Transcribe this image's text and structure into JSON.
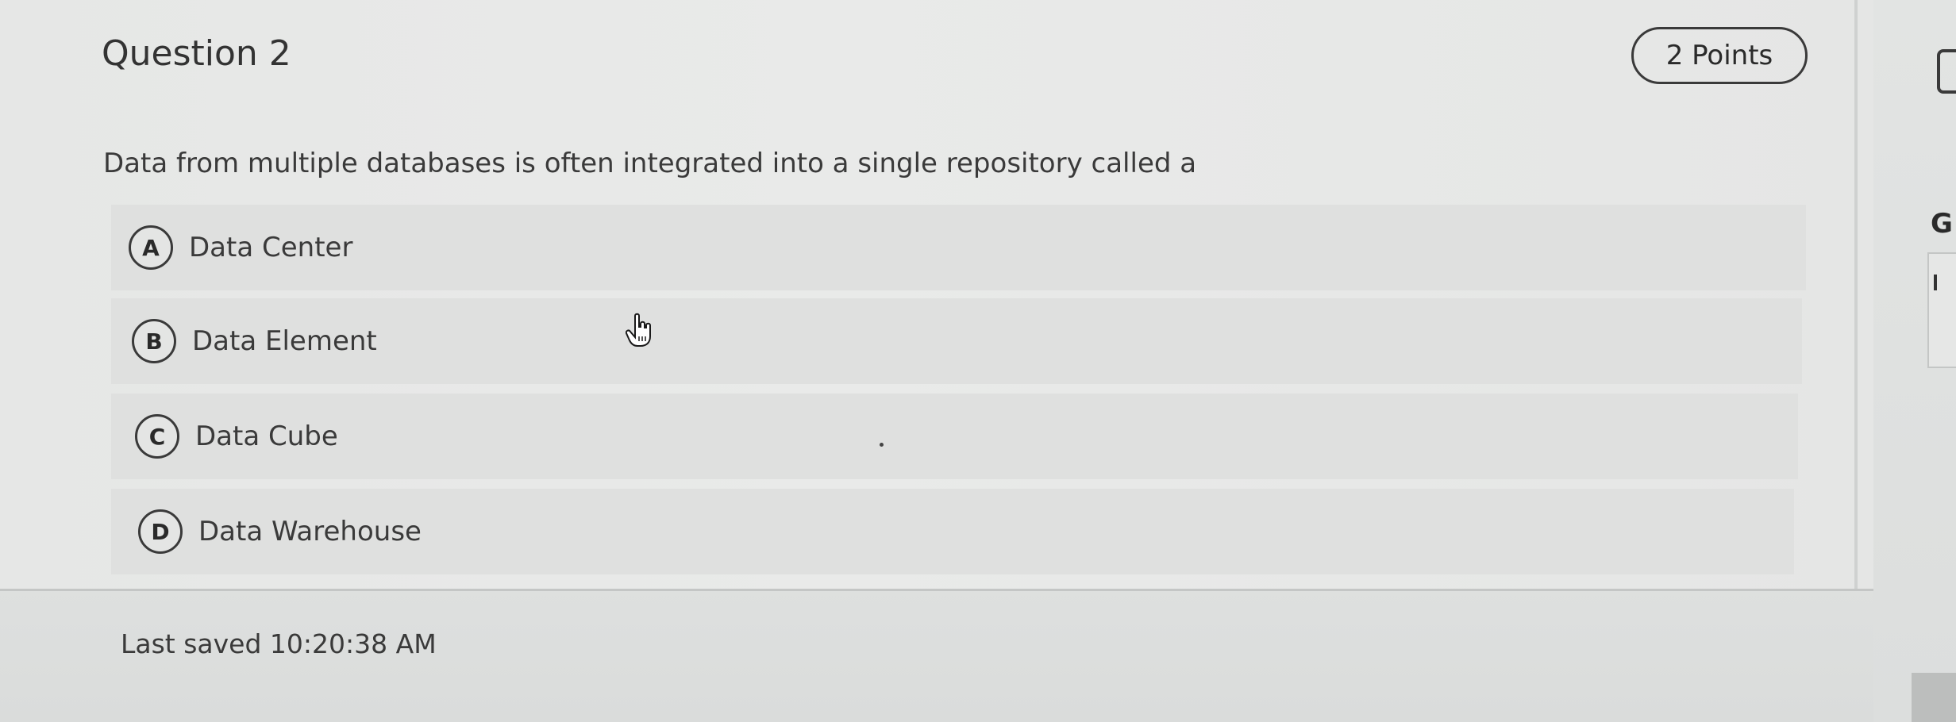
{
  "question": {
    "title": "Question 2",
    "points_label": "2 Points",
    "text": "Data from multiple databases is often integrated into a single repository called a"
  },
  "options": [
    {
      "letter": "A",
      "label": "Data Center"
    },
    {
      "letter": "B",
      "label": "Data Element"
    },
    {
      "letter": "C",
      "label": "Data Cube"
    },
    {
      "letter": "D",
      "label": "Data Warehouse"
    }
  ],
  "footer": {
    "last_saved": "Last saved 10:20:38 AM"
  },
  "side_panel": {
    "partial_heading": "G"
  },
  "icons": {
    "cursor": "hand-pointer-icon",
    "panel_icon": "save-icon"
  },
  "colors": {
    "background": "#e8e9e8",
    "option_background": "#dfe0df",
    "text": "#3a3a3a",
    "border": "#3a3a3a"
  }
}
